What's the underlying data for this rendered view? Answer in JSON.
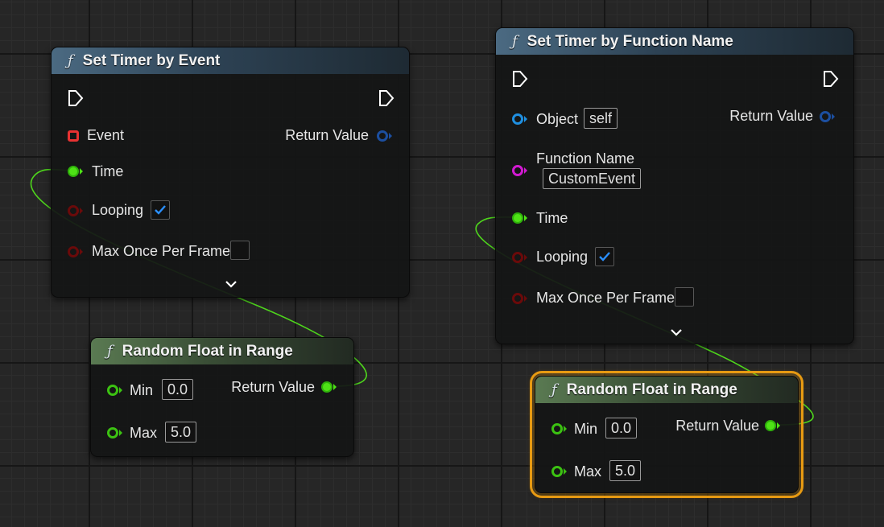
{
  "nodes": {
    "set_timer_event": {
      "title": "Set Timer by Event",
      "event_label": "Event",
      "return_label": "Return Value",
      "time_label": "Time",
      "looping_label": "Looping",
      "looping_checked": true,
      "max_once_label": "Max Once Per Frame",
      "max_once_checked": false
    },
    "random_float_left": {
      "title": "Random Float in Range",
      "min_label": "Min",
      "min_value": "0.0",
      "max_label": "Max",
      "max_value": "5.0",
      "return_label": "Return Value"
    },
    "set_timer_function": {
      "title": "Set Timer by Function Name",
      "object_label": "Object",
      "object_value": "self",
      "return_label": "Return Value",
      "function_name_label": "Function Name",
      "function_name_value": "CustomEvent",
      "time_label": "Time",
      "looping_label": "Looping",
      "looping_checked": true,
      "max_once_label": "Max Once Per Frame",
      "max_once_checked": false
    },
    "random_float_right": {
      "title": "Random Float in Range",
      "min_label": "Min",
      "min_value": "0.0",
      "max_label": "Max",
      "max_value": "5.0",
      "return_label": "Return Value",
      "selected": true
    }
  },
  "icons": {
    "function": "function-icon",
    "exec": "exec-pin-icon",
    "expand": "chevron-down-icon",
    "check": "checkmark-icon"
  },
  "colors": {
    "float_pin": "#4ee216",
    "bool_pin": "#6a0a0a",
    "exec_pin": "#ffffff",
    "event_pin": "#e83232",
    "object_pin": "#1f8fe0",
    "name_pin": "#d21ad2",
    "wire": "#4ed51c",
    "selection": "#e79a12",
    "function_header": "#4b6a82",
    "pure_function_header": "#5a7a52"
  }
}
